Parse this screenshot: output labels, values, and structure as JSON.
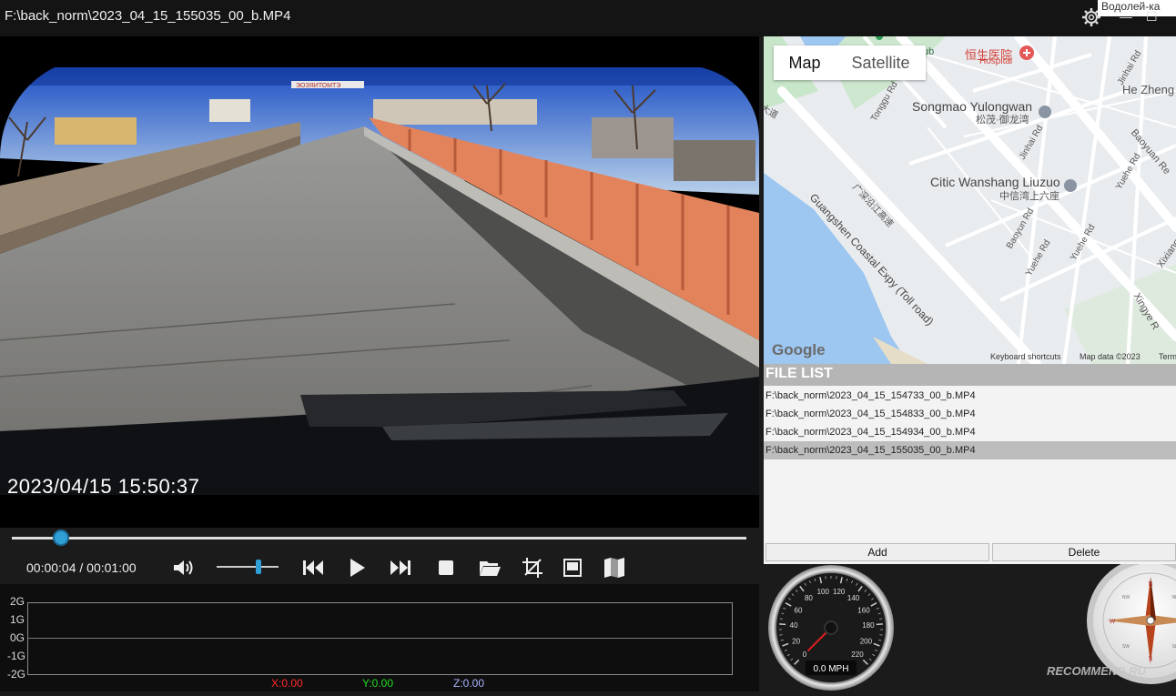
{
  "window": {
    "title": "F:\\back_norm\\2023_04_15_155035_00_b.MP4",
    "overlay_text": "Водолей-ка"
  },
  "video": {
    "timestamp": "2023/04/15 15:50:37",
    "sign_text": "ЭОЗЯИТОМТЭ"
  },
  "player": {
    "time": "00:00:04 / 00:01:00",
    "progress_fraction": 0.067,
    "volume_fraction": 0.68,
    "icons": [
      "volume-icon",
      "previous-icon",
      "play-icon",
      "next-icon",
      "stop-icon",
      "open-folder-icon",
      "snapshot-icon",
      "fullscreen-icon",
      "map-toggle-icon"
    ]
  },
  "gsensor": {
    "labels": [
      "2G",
      "1G",
      "0G",
      "-1G",
      "-2G"
    ],
    "x": "X:0.00",
    "y": "Y:0.00",
    "z": "Z:0.00",
    "colors": {
      "x": "#ff2a2a",
      "y": "#22dd22",
      "z": "#aab4ff"
    }
  },
  "map": {
    "tab_map": "Map",
    "tab_satellite": "Satellite",
    "labels": {
      "hospital_cn": "恒生医院",
      "hospital_en": "Hospital",
      "songmao": "Songmao Yulongwan",
      "songmao_cn": "松茂·御龙湾",
      "citic": "Citic Wanshang Liuzuo",
      "citic_cn": "中信湾上六座",
      "expy": "Guangshen Coastal Expy (Toll road)",
      "expy_cn": "广深沿江高速",
      "tonggu": "Tonggu Rd",
      "jinhai1": "Jinhai Rd",
      "jinhai2": "Jinhai Rd",
      "he_zheng": "He Zheng",
      "baoyuan": "Baoyuan Re",
      "baoyun": "Baoyun Rd",
      "yuehe1": "Yuehe Rd",
      "yuehe2": "Yuehe Rd",
      "yuehe3": "Yuehe Rd",
      "xixiang": "Xixiang",
      "xingye": "Xingye R",
      "ub": "ub",
      "dadao": "大道",
      "google": "Google",
      "shortcuts": "Keyboard shortcuts",
      "mapdata": "Map data ©2023",
      "terms": "Term"
    }
  },
  "filelist": {
    "header": "FILE LIST",
    "files": [
      "F:\\back_norm\\2023_04_15_154733_00_b.MP4",
      "F:\\back_norm\\2023_04_15_154833_00_b.MP4",
      "F:\\back_norm\\2023_04_15_154934_00_b.MP4",
      "F:\\back_norm\\2023_04_15_155035_00_b.MP4"
    ],
    "selected_index": 3,
    "add_label": "Add",
    "delete_label": "Delete"
  },
  "speedometer": {
    "ticks": [
      "0",
      "20",
      "40",
      "60",
      "80",
      "100",
      "120",
      "140",
      "160",
      "180",
      "200",
      "220"
    ],
    "readout": "0.0 MPH",
    "value": 0
  },
  "compass": {
    "n": "N",
    "s": "S",
    "e": "E",
    "w": "W",
    "ne": "NE",
    "nw": "NW",
    "se": "SE",
    "sw": "SW"
  },
  "watermark": "RECOMMEND.RU"
}
